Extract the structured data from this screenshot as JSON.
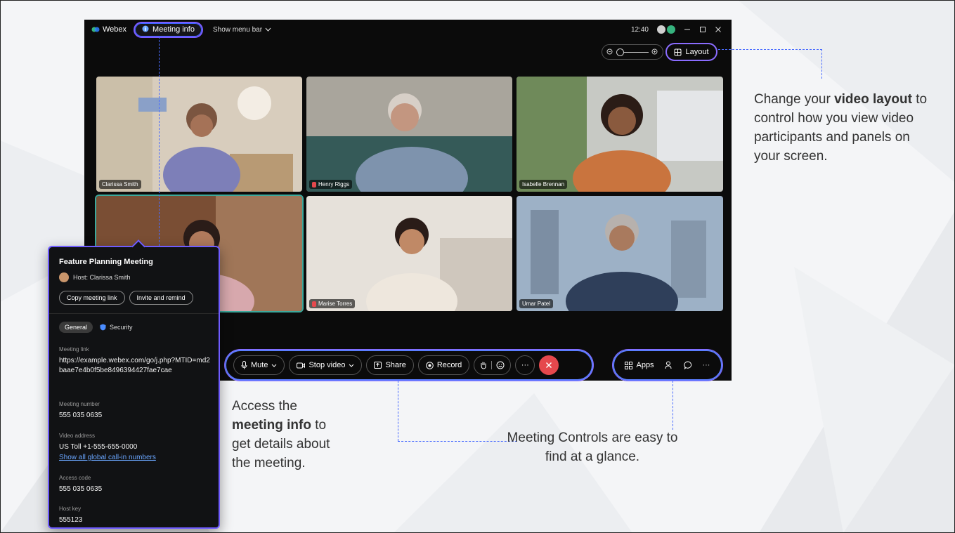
{
  "titlebar": {
    "brand": "Webex",
    "meeting_info_label": "Meeting info",
    "show_menu_bar_label": "Show menu bar",
    "time": "12:40"
  },
  "view": {
    "layout_label": "Layout"
  },
  "participants": [
    {
      "name": "Clarissa Smith",
      "muted": false,
      "active": false
    },
    {
      "name": "Henry Riggs",
      "muted": true,
      "active": false
    },
    {
      "name": "Isabelle Brennan",
      "muted": false,
      "active": false
    },
    {
      "name": "",
      "muted": false,
      "active": true
    },
    {
      "name": "Marise Torres",
      "muted": true,
      "active": false
    },
    {
      "name": "Umar Patel",
      "muted": false,
      "active": false
    }
  ],
  "controls": {
    "mute_label": "Mute",
    "stop_video_label": "Stop video",
    "share_label": "Share",
    "record_label": "Record",
    "more_label": "···",
    "apps_label": "Apps"
  },
  "panel": {
    "title": "Feature Planning Meeting",
    "host": "Host: Clarissa Smith",
    "copy_link_label": "Copy meeting link",
    "invite_label": "Invite and remind",
    "tab_general": "General",
    "tab_security": "Security",
    "meeting_link_label": "Meeting link",
    "meeting_link_value": "https://example.webex.com/go/j.php?MTID=md2baae7e4b0f5be8496394427fae7cae",
    "meeting_number_label": "Meeting number",
    "meeting_number_value": "555 035 0635",
    "video_address_label": "Video address",
    "video_address_value": "US Toll +1-555-655-0000",
    "global_numbers_link": "Show all global call-in numbers",
    "access_code_label": "Access code",
    "access_code_value": "555 035 0635",
    "host_key_label": "Host key",
    "host_key_value": "555123"
  },
  "annotations": {
    "layout_pre": "Change your ",
    "layout_bold": "video layout",
    "layout_post": " to control how you view video participants and panels on your screen.",
    "info_pre": "Access the ",
    "info_bold": "meeting info",
    "info_post": " to get details about the meeting.",
    "controls_text": "Meeting Controls are easy to find at a glance."
  },
  "colors": {
    "accent_purple": "#8a6cff",
    "accent_blue": "#4a6cff",
    "end_red": "#e5484d",
    "active_speaker": "#3ba99c"
  }
}
